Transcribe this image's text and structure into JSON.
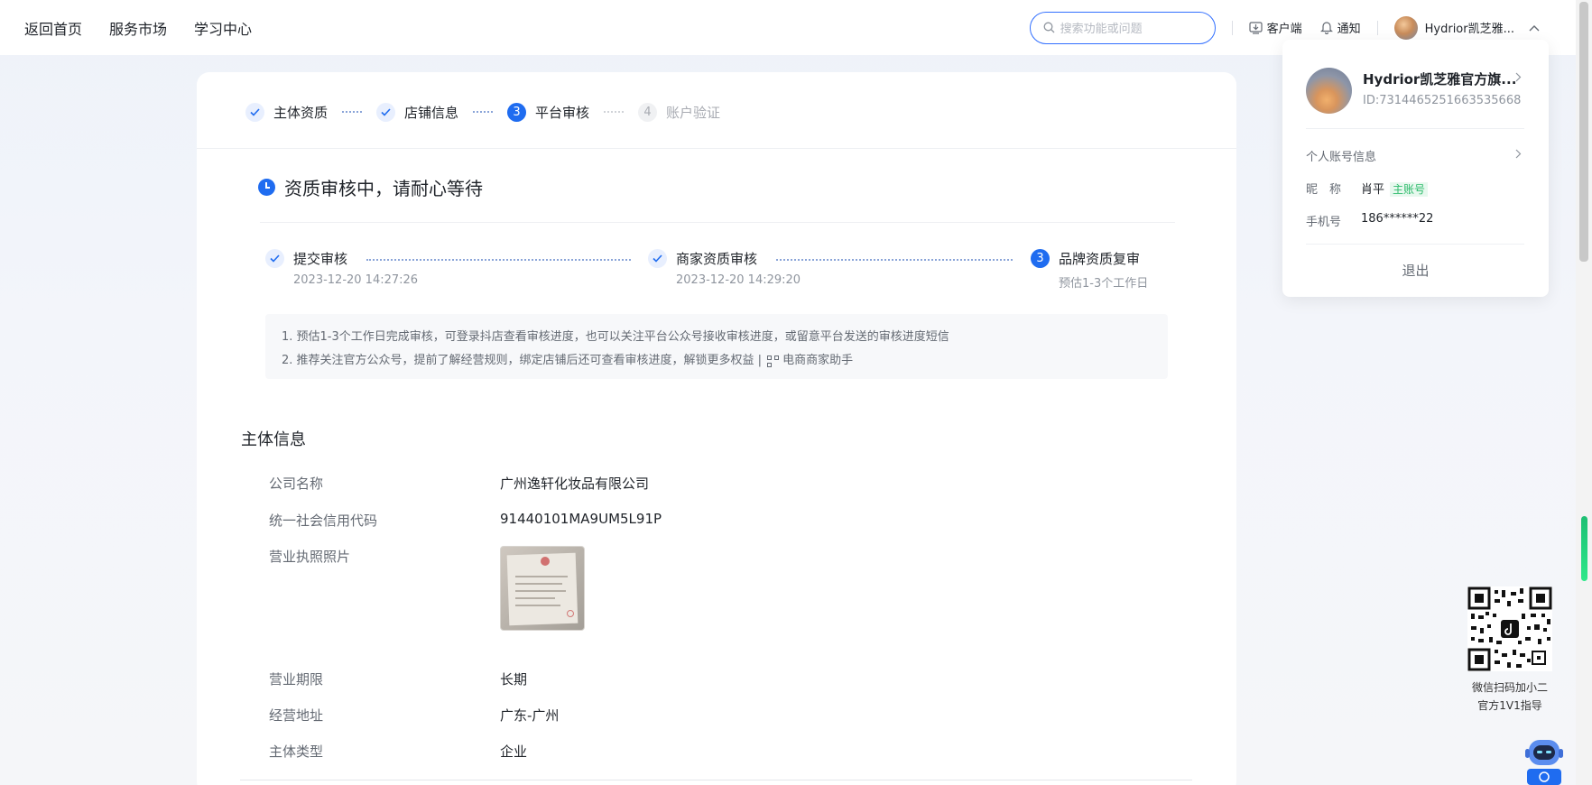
{
  "topnav": {
    "links": [
      "返回首页",
      "服务市场",
      "学习中心"
    ],
    "search_placeholder": "搜索功能或问题",
    "client_label": "客户端",
    "notify_label": "通知",
    "user_name": "Hydrior凯芝雅..."
  },
  "steps": {
    "s1": "主体资质",
    "s2": "店铺信息",
    "s3_num": "3",
    "s3": "平台审核",
    "s4_num": "4",
    "s4": "账户验证"
  },
  "status": {
    "title": "资质审核中，请耐心等待"
  },
  "progress": {
    "p1_label": "提交审核",
    "p1_time": "2023-12-20 14:27:26",
    "p2_label": "商家资质审核",
    "p2_time": "2023-12-20 14:29:20",
    "p3_num": "3",
    "p3_label": "品牌资质复审",
    "p3_time": "预估1-3个工作日"
  },
  "notes": {
    "line1": "1. 预估1-3个工作日完成审核，可登录抖店查看审核进度，也可以关注平台公众号接收审核进度，或留意平台发送的审核进度短信",
    "line2": "2. 推荐关注官方公众号，提前了解经营规则，绑定店铺后还可查看审核进度，解锁更多权益 |",
    "assistant": "电商商家助手"
  },
  "subject": {
    "title": "主体信息",
    "company_label": "公司名称",
    "company_value": "广州逸轩化妆品有限公司",
    "credit_label": "统一社会信用代码",
    "credit_value": "91440101MA9UM5L91P",
    "license_label": "营业执照照片",
    "term_label": "营业期限",
    "term_value": "长期",
    "address_label": "经营地址",
    "address_value": "广东-广州",
    "type_label": "主体类型",
    "type_value": "企业"
  },
  "dropdown": {
    "name": "Hydrior凯芝雅官方旗...",
    "id": "ID:7314465251663535668",
    "account_info": "个人账号信息",
    "nickname_label": "昵　称",
    "nickname_value": "肖平",
    "badge": "主账号",
    "phone_label": "手机号",
    "phone_value": "186******22",
    "logout": "退出"
  },
  "qr_float": {
    "line1": "微信扫码加小二",
    "line2": "官方1V1指导"
  },
  "colors": {
    "accent": "#1f6cf0",
    "badge_green": "#2dbb6b"
  }
}
